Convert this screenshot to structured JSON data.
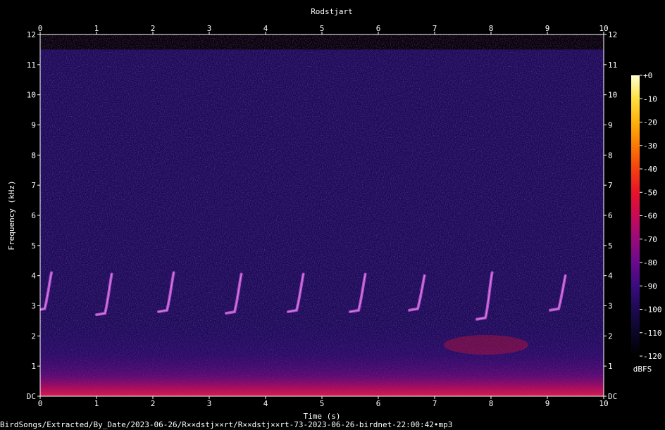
{
  "chart_data": {
    "type": "heatmap",
    "title": "Rodstjart",
    "xlabel": "Time (s)",
    "ylabel": "Frequency (kHz)",
    "xlim": [
      0,
      10
    ],
    "ylim": [
      0,
      12
    ],
    "x_ticks": [
      "0",
      "1",
      "2",
      "3",
      "4",
      "5",
      "6",
      "7",
      "8",
      "9",
      "10"
    ],
    "y_ticks": [
      "DC",
      "1",
      "2",
      "3",
      "4",
      "5",
      "6",
      "7",
      "8",
      "9",
      "10",
      "11",
      "12"
    ],
    "colorbar": {
      "label": "dBFS",
      "ticks": [
        "+0",
        "-10",
        "-20",
        "-30",
        "-40",
        "-50",
        "-60",
        "-70",
        "-80",
        "-90",
        "-100",
        "-110",
        "-120"
      ],
      "range": [
        -120,
        0
      ],
      "colors": [
        "#000000",
        "#0b0626",
        "#1e0a52",
        "#3a0b80",
        "#6a0a8e",
        "#9a0a7a",
        "#c90a55",
        "#e8132a",
        "#f5400f",
        "#fb7a05",
        "#fdb10b",
        "#fde040",
        "#ffffd0"
      ]
    },
    "background_level_dBFS": -105,
    "high_freq_cutoff_kHz": 11.5,
    "calls": [
      {
        "t": 0.08,
        "f_low": 2.9,
        "f_high": 4.1
      },
      {
        "t": 1.15,
        "f_low": 2.75,
        "f_high": 4.05
      },
      {
        "t": 2.25,
        "f_low": 2.85,
        "f_high": 4.1
      },
      {
        "t": 3.45,
        "f_low": 2.8,
        "f_high": 4.05
      },
      {
        "t": 4.55,
        "f_low": 2.85,
        "f_high": 4.05
      },
      {
        "t": 5.65,
        "f_low": 2.85,
        "f_high": 4.05
      },
      {
        "t": 6.7,
        "f_low": 2.9,
        "f_high": 4.0
      },
      {
        "t": 7.9,
        "f_low": 2.6,
        "f_high": 4.1
      },
      {
        "t": 9.2,
        "f_low": 2.9,
        "f_high": 4.0
      }
    ]
  },
  "footer": {
    "file_path": "BirdSongs/Extracted/By_Date/2023-06-26/R××dstj××rt/R××dstj××rt-73-2023-06-26-birdnet-22:00:42•mp3"
  }
}
